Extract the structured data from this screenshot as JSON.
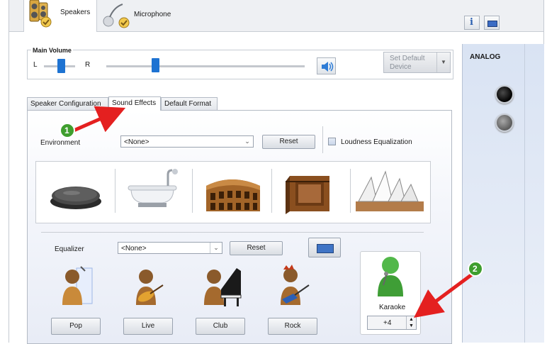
{
  "device_tabs": {
    "speakers": "Speakers",
    "microphone": "Microphone"
  },
  "main_volume": {
    "title": "Main Volume",
    "left_label": "L",
    "right_label": "R",
    "set_default_label": "Set Default Device"
  },
  "side_panel": {
    "title": "ANALOG"
  },
  "subtabs": [
    "Speaker Configuration",
    "Sound Effects",
    "Default Format"
  ],
  "environment": {
    "label": "Environment",
    "selected": "<None>",
    "reset_label": "Reset",
    "loudness_label": "Loudness Equalization",
    "loudness_checked": false,
    "presets": [
      "stone-icon",
      "bathtub-icon",
      "colosseum-icon",
      "wooden-box-icon",
      "opera-house-icon"
    ]
  },
  "equalizer": {
    "label": "Equalizer",
    "selected": "<None>",
    "reset_label": "Reset",
    "presets": [
      "Pop",
      "Live",
      "Club",
      "Rock"
    ]
  },
  "karaoke": {
    "label": "Karaoke",
    "value": "+4"
  },
  "annotations": {
    "marker1": "1",
    "marker2": "2",
    "arrow_color": "#e42020",
    "marker_color": "#3f9e2e"
  },
  "colors": {
    "accent": "#1e73d2",
    "panel_bg": "#eef1f8",
    "side_bg": "#dde6f4"
  }
}
